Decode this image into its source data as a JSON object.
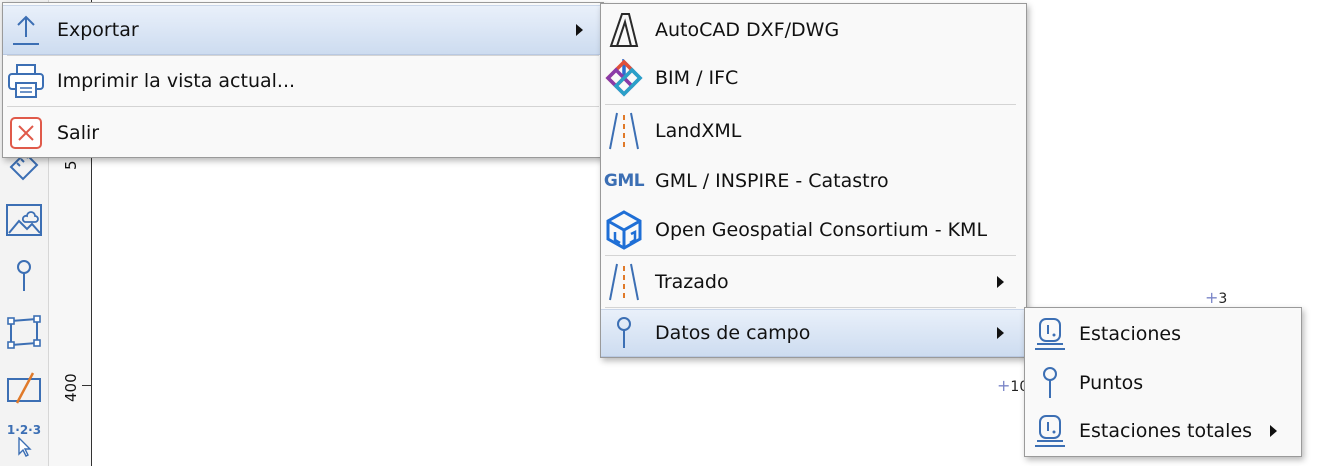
{
  "background": {
    "ruler": {
      "label_top": "5",
      "label_bottom": "400"
    },
    "toolbar": {
      "tools": [
        {
          "icon": "ruler-measure-icon"
        },
        {
          "icon": "image-icon"
        },
        {
          "icon": "point-pin-icon"
        },
        {
          "icon": "polygon-icon"
        },
        {
          "icon": "line-icon"
        },
        {
          "icon": "numbering-cursor-icon",
          "text": "1·2·3"
        }
      ]
    },
    "canvas": {
      "markers": [
        {
          "label": "3"
        },
        {
          "label": "10"
        }
      ]
    }
  },
  "file_menu": {
    "items": [
      {
        "label": "Exportar",
        "icon": "upload-icon",
        "has_submenu": true,
        "highlighted": true
      },
      {
        "label": "Imprimir la vista actual...",
        "icon": "printer-icon"
      },
      {
        "label": "Salir",
        "icon": "close-icon"
      }
    ]
  },
  "export_menu": {
    "items": [
      {
        "label": "AutoCAD DXF/DWG",
        "icon": "autocad-icon"
      },
      {
        "label": "BIM / IFC",
        "icon": "ifc-icon"
      },
      {
        "label": "LandXML",
        "icon": "road-alignment-icon"
      },
      {
        "label": "GML / INSPIRE - Catastro",
        "icon": "gml-icon",
        "icon_text": "GML"
      },
      {
        "label": "Open Geospatial Consortium - KML",
        "icon": "ogc-icon"
      },
      {
        "label": "Trazado",
        "icon": "road-alignment-icon",
        "has_submenu": true
      },
      {
        "label": "Datos de campo",
        "icon": "point-pin-icon",
        "has_submenu": true,
        "highlighted": true
      }
    ]
  },
  "field_data_menu": {
    "items": [
      {
        "label": "Estaciones",
        "icon": "station-icon"
      },
      {
        "label": "Puntos",
        "icon": "point-pin-icon"
      },
      {
        "label": "Estaciones totales",
        "icon": "station-icon",
        "has_submenu": true
      }
    ]
  },
  "colors": {
    "accent": "#3c6fb4",
    "highlight": "#cddcf0",
    "close_red": "#e05a4a"
  }
}
